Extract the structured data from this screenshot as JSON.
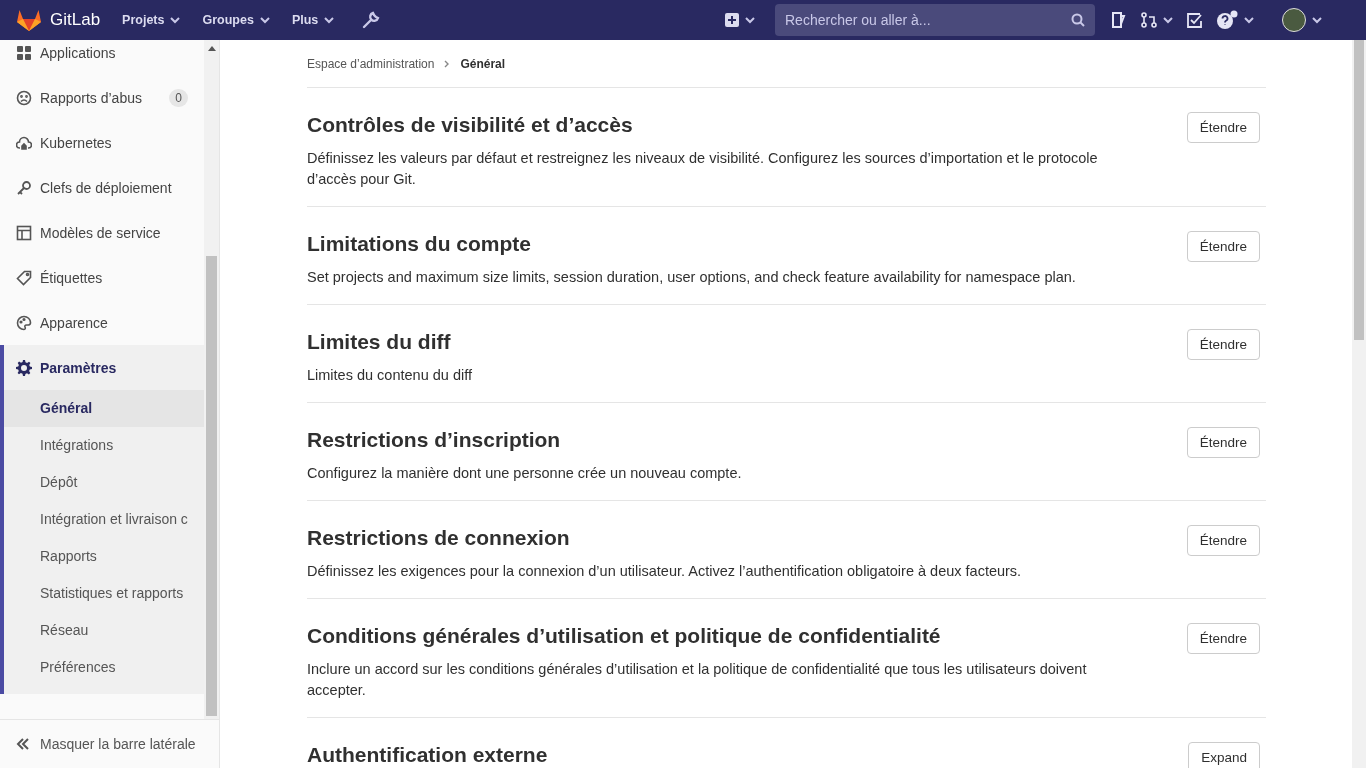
{
  "topbar": {
    "brand": "GitLab",
    "menus": [
      {
        "label": "Projets"
      },
      {
        "label": "Groupes"
      },
      {
        "label": "Plus"
      }
    ],
    "search": {
      "placeholder": "Rechercher ou aller à..."
    }
  },
  "sidebar": {
    "items": [
      {
        "label": "Applications",
        "kind": "grid"
      },
      {
        "label": "Rapports d’abus",
        "kind": "face",
        "badge": "0"
      },
      {
        "label": "Kubernetes",
        "kind": "cloud"
      },
      {
        "label": "Clefs de déploiement",
        "kind": "key"
      },
      {
        "label": "Modèles de service",
        "kind": "layout"
      },
      {
        "label": "Étiquettes",
        "kind": "tag"
      },
      {
        "label": "Apparence",
        "kind": "palette"
      },
      {
        "label": "Paramètres",
        "kind": "gear",
        "expanded": true,
        "children": [
          {
            "label": "Général",
            "selected": true
          },
          {
            "label": "Intégrations",
            "selected": false
          },
          {
            "label": "Dépôt",
            "selected": false
          },
          {
            "label": "Intégration et livraison c",
            "selected": false
          },
          {
            "label": "Rapports",
            "selected": false
          },
          {
            "label": "Statistiques et rapports",
            "selected": false
          },
          {
            "label": "Réseau",
            "selected": false
          },
          {
            "label": "Préférences",
            "selected": false
          }
        ]
      }
    ],
    "collapse": "Masquer la barre latérale"
  },
  "breadcrumb": [
    "Espace d’administration",
    "Général"
  ],
  "sections": [
    {
      "title": "Contrôles de visibilité et d’accès",
      "description": "Définissez les valeurs par défaut et restreignez les niveaux de visibilité. Configurez les sources d’importation et le protocole d’accès pour Git.",
      "button": "Étendre"
    },
    {
      "title": "Limitations du compte",
      "description": "Set projects and maximum size limits, session duration, user options, and check feature availability for namespace plan.",
      "button": "Étendre"
    },
    {
      "title": "Limites du diff",
      "description": "Limites du contenu du diff",
      "button": "Étendre"
    },
    {
      "title": "Restrictions d’inscription",
      "description": "Configurez la manière dont une personne crée un nouveau compte.",
      "button": "Étendre"
    },
    {
      "title": "Restrictions de connexion",
      "description": "Définissez les exigences pour la connexion d’un utilisateur. Activez l’authentification obligatoire à deux facteurs.",
      "button": "Étendre"
    },
    {
      "title": "Conditions générales d’utilisation et politique de confidentialité",
      "description": "Inclure un accord sur les conditions générales d’utilisation et la politique de confidentialité que tous les utilisateurs doivent accepter.",
      "button": "Étendre"
    },
    {
      "title": "Authentification externe",
      "button": "Expand"
    }
  ]
}
